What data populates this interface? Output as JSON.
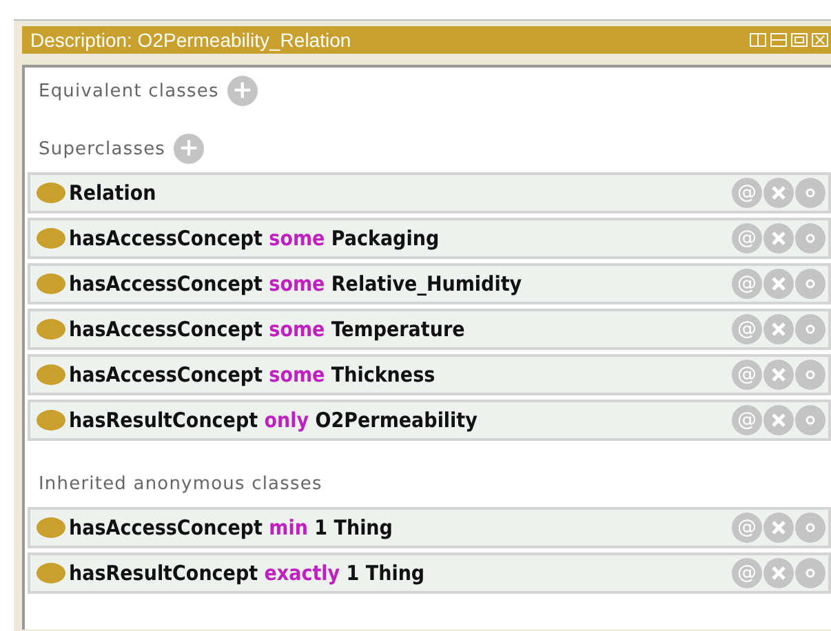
{
  "panel": {
    "title": "Description: O2Permeability_Relation"
  },
  "sections": [
    {
      "label": "Equivalent classes",
      "add_symbol": "+"
    },
    {
      "label": "Superclasses",
      "add_symbol": "+",
      "rows": [
        {
          "kind": "class",
          "text": "Relation",
          "annotate": "@"
        },
        {
          "kind": "restriction",
          "property": "hasAccessConcept",
          "keyword": "some",
          "filler": "Packaging",
          "annotate": "@"
        },
        {
          "kind": "restriction",
          "property": "hasAccessConcept",
          "keyword": "some",
          "filler": "Relative_Humidity",
          "annotate": "@"
        },
        {
          "kind": "restriction",
          "property": "hasAccessConcept",
          "keyword": "some",
          "filler": "Temperature",
          "annotate": "@"
        },
        {
          "kind": "restriction",
          "property": "hasAccessConcept",
          "keyword": "some",
          "filler": "Thickness",
          "annotate": "@"
        },
        {
          "kind": "restriction",
          "property": "hasResultConcept",
          "keyword": "only",
          "filler": "O2Permeability",
          "annotate": "@"
        }
      ]
    },
    {
      "label": "Inherited anonymous classes",
      "rows": [
        {
          "kind": "restriction",
          "property": "hasAccessConcept",
          "keyword": "min",
          "filler": "1 Thing",
          "annotate": "@"
        },
        {
          "kind": "restriction",
          "property": "hasResultConcept",
          "keyword": "exactly",
          "filler": "1 Thing",
          "annotate": "@"
        }
      ]
    }
  ]
}
